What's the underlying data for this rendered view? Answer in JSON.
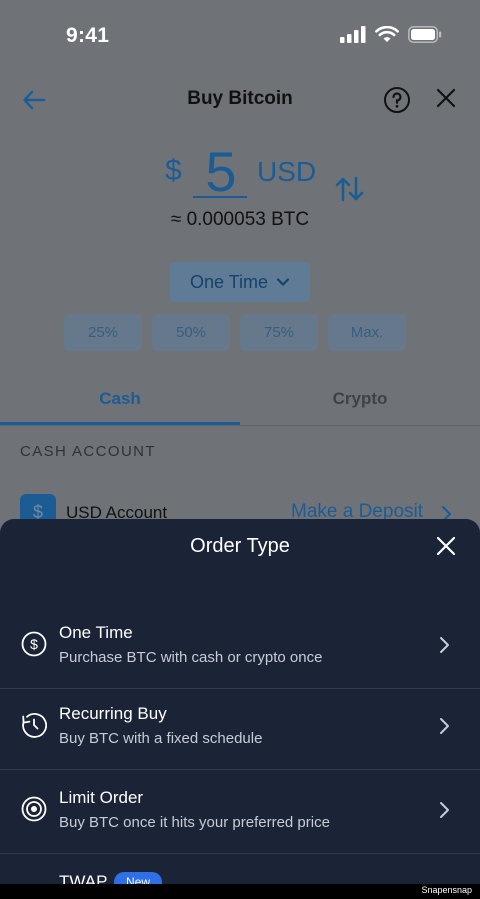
{
  "status_bar": {
    "time": "9:41"
  },
  "header": {
    "title": "Buy Bitcoin"
  },
  "amount": {
    "currency_symbol": "$",
    "value": "5",
    "currency_code": "USD",
    "conversion": "≈ 0.000053 BTC"
  },
  "order_type_selector": {
    "label": "One Time"
  },
  "percent_chips": [
    "25%",
    "50%",
    "75%",
    "Max."
  ],
  "tabs": [
    {
      "label": "Cash",
      "active": true
    },
    {
      "label": "Crypto",
      "active": false
    }
  ],
  "cash_section": {
    "label": "CASH ACCOUNT",
    "account_icon_glyph": "$",
    "account_name": "USD Account",
    "deposit_link": "Make a Deposit"
  },
  "sheet": {
    "title": "Order Type",
    "options": [
      {
        "title": "One Time",
        "subtitle": "Purchase BTC with cash or crypto once",
        "icon": "dollar-circle-icon"
      },
      {
        "title": "Recurring Buy",
        "subtitle": "Buy BTC with a fixed schedule",
        "icon": "clock-icon"
      },
      {
        "title": "Limit Order",
        "subtitle": "Buy BTC once it hits your preferred price",
        "icon": "target-icon"
      },
      {
        "title": "TWAP",
        "badge": "New",
        "icon": "twap-icon"
      }
    ]
  },
  "watermark": "Snapensnap",
  "colors": {
    "dimmed_background": "#6f7378",
    "accent": "#1c5c95",
    "sheet_background": "#1b2337",
    "badge": "#2f6fe8"
  }
}
